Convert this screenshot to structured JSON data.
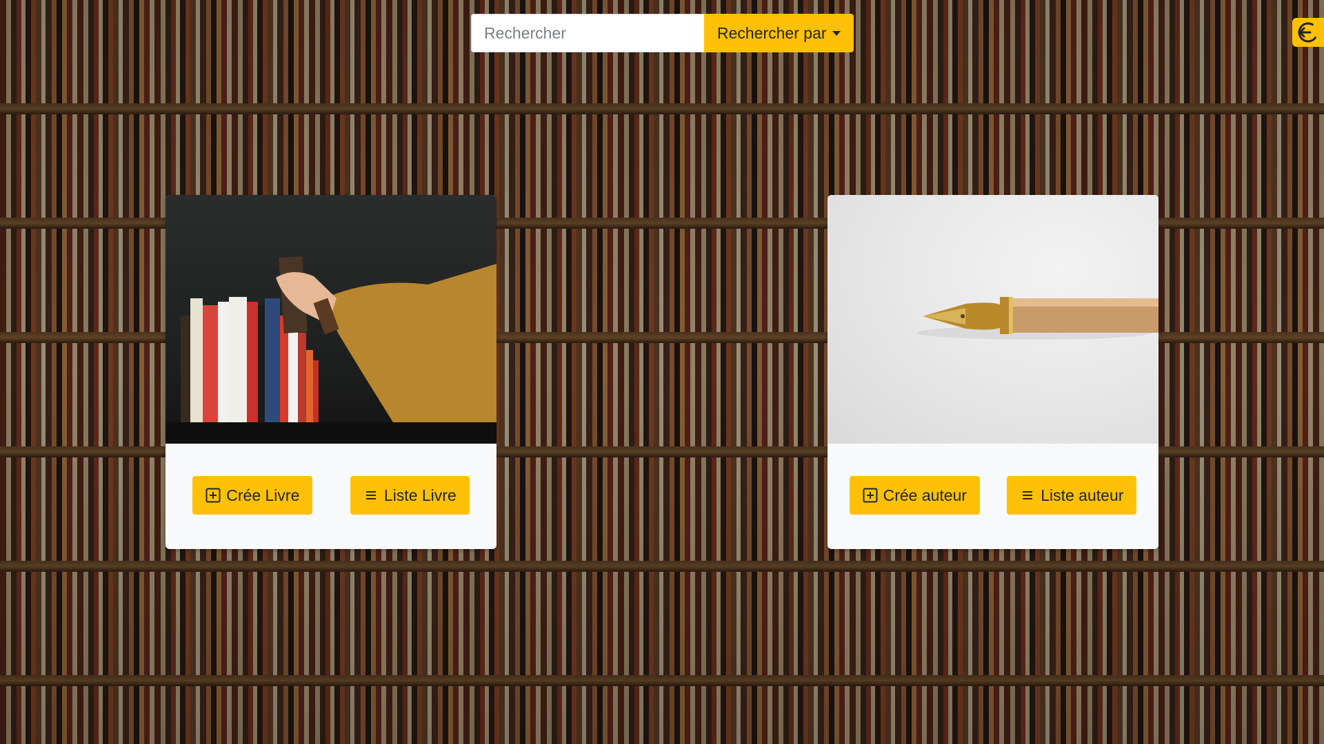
{
  "search": {
    "placeholder": "Rechercher",
    "value": "",
    "search_by_label": "Rechercher par"
  },
  "header": {
    "logout_icon": "logout-icon"
  },
  "cards": [
    {
      "image": "books-shelf-photo",
      "actions": [
        {
          "label": "Crée Livre",
          "icon": "plus-square-icon"
        },
        {
          "label": "Liste Livre",
          "icon": "list-icon"
        }
      ]
    },
    {
      "image": "fountain-pen-photo",
      "actions": [
        {
          "label": "Crée auteur",
          "icon": "plus-square-icon"
        },
        {
          "label": "Liste auteur",
          "icon": "list-icon"
        }
      ]
    }
  ],
  "colors": {
    "accent": "#ffc107",
    "card_bg": "#f8f9fa"
  }
}
